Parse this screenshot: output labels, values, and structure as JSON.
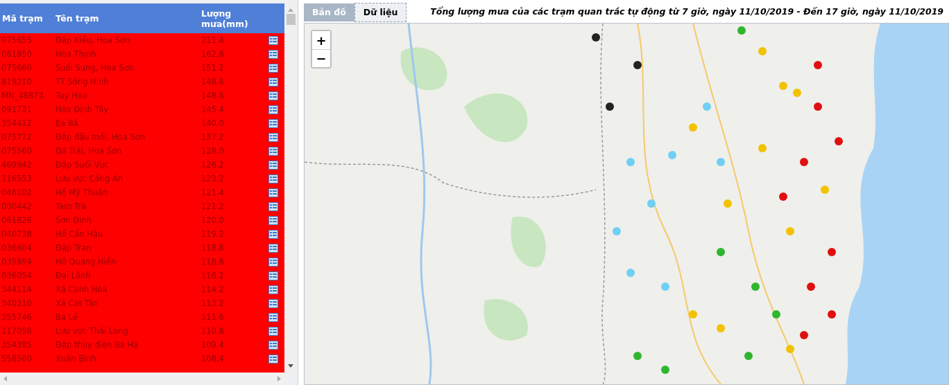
{
  "table": {
    "columns": [
      "Mã trạm",
      "Tên trạm",
      "Lượng mưa(mm)"
    ],
    "rows": [
      [
        "075655",
        "Đập Kiểu, Hoa Sơn",
        "211.4"
      ],
      [
        "061850",
        "Hòa Thịnh",
        "162.8"
      ],
      [
        "075660",
        "Suối Sung, Hoa Sơn",
        "151.2"
      ],
      [
        "819210",
        "TT Sông Hinh",
        "148.6"
      ],
      [
        "MN_48873",
        "Tuy Hoa",
        "148.6"
      ],
      [
        "091731",
        "Hòa Định Tây",
        "145.4"
      ],
      [
        "354412",
        "Ea Bá",
        "140.0"
      ],
      [
        "075772",
        "Đập đầu mối, Hoa Sơn",
        "137.2"
      ],
      [
        "075560",
        "Đá Trải, Hoa Sơn",
        "128.0"
      ],
      [
        "469942",
        "Đập Suối Vực",
        "126.2"
      ],
      [
        "116553",
        "Lưu vực Công An",
        "123.2"
      ],
      [
        "046102",
        "Hồ Mỹ Thuận",
        "121.4"
      ],
      [
        "000442",
        "Tam Trà",
        "121.2"
      ],
      [
        "061826",
        "Sơn Định",
        "120.0"
      ],
      [
        "040738",
        "Hồ Cẩn Hậu",
        "119.2"
      ],
      [
        "036604",
        "Đập Tran",
        "118.8"
      ],
      [
        "039894",
        "Hồ Quang Hiển",
        "118.8"
      ],
      [
        "036054",
        "Đại Lãnh",
        "116.2"
      ],
      [
        "344114",
        "Xã Canh Hòa",
        "114.2"
      ],
      [
        "340310",
        "Xã Cát Tân",
        "113.2"
      ],
      [
        "355746",
        "Ba Lế",
        "111.6"
      ],
      [
        "117056",
        "Lưu vực Thái Long",
        "110.8"
      ],
      [
        "354395",
        "Đập thủy điện Ba Hạ",
        "109.4"
      ],
      [
        "558500",
        "Xuân Bình",
        "108.4"
      ]
    ]
  },
  "tabs": [
    {
      "label": "Bản đồ",
      "selected": false
    },
    {
      "label": "Dữ liệu",
      "selected": true
    }
  ],
  "title": "Tổng lượng mưa của các trạm quan trắc tự động từ 7 giờ, ngày 11/10/2019 - Đến 17 giờ, ngày 11/10/2019",
  "map": {
    "zoom_in": "+",
    "zoom_out": "−"
  }
}
